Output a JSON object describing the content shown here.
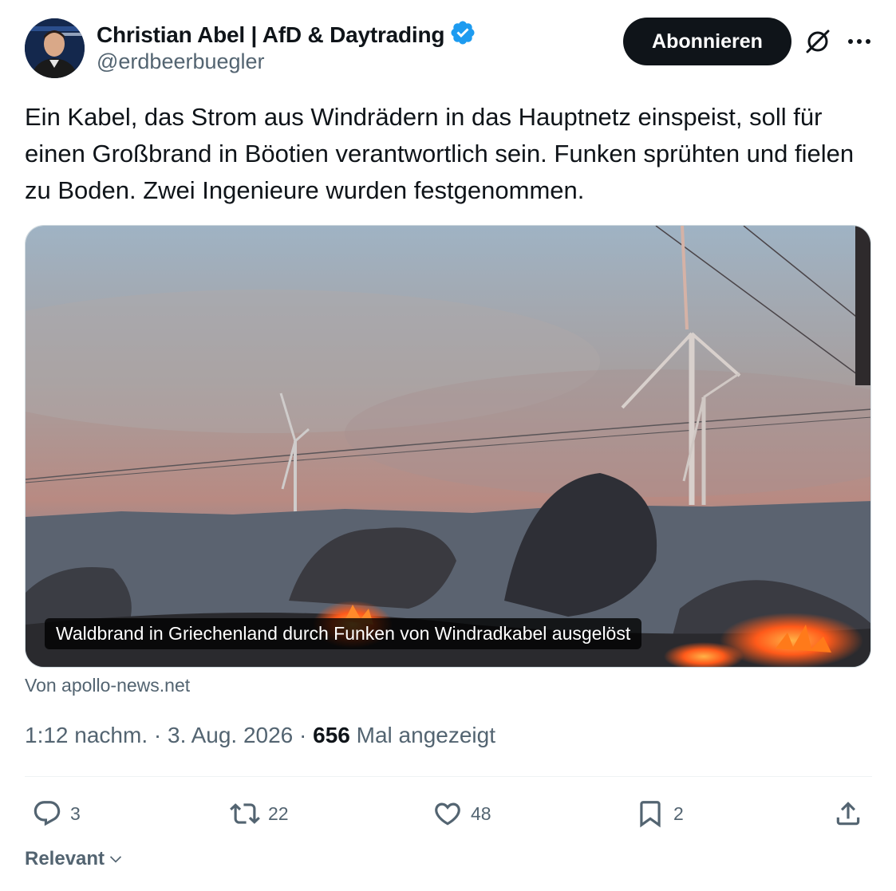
{
  "author": {
    "name": "Christian Abel | AfD & Daytrading",
    "handle": "@erdbeerbuegler",
    "verified": true,
    "verified_color": "#1d9bf0"
  },
  "header": {
    "follow_label": "Abonnieren",
    "grok_icon": "grok-icon",
    "more_icon": "more-icon"
  },
  "tweet": {
    "text": "Ein Kabel, das Strom aus Windrädern in das Hauptnetz einspeist, soll für einen Großbrand in Böotien verantwortlich sein. Funken sprühten und fielen zu Boden. Zwei Ingenieure wurden festgenommen."
  },
  "card": {
    "caption": "Waldbrand in Griechenland durch Funken von Windradkabel ausgelöst",
    "source": "Von apollo-news.net"
  },
  "meta": {
    "time": "1:12 nachm.",
    "separator": " · ",
    "date": "3. Aug. 2026",
    "views_count": "656",
    "views_label": " Mal angezeigt"
  },
  "actions": {
    "replies": "3",
    "reposts": "22",
    "likes": "48",
    "bookmarks": "2"
  },
  "sort": {
    "label": "Relevant"
  },
  "colors": {
    "text": "#0f1419",
    "secondary": "#536471",
    "button_bg": "#0f1419",
    "fire": "#ff5a1a"
  }
}
